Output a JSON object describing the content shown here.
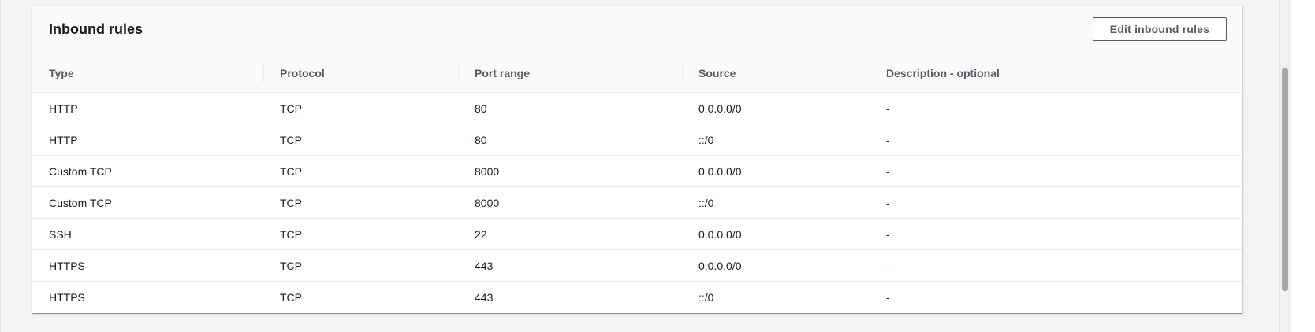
{
  "panel": {
    "title": "Inbound rules",
    "edit_button_label": "Edit inbound rules"
  },
  "table": {
    "columns": [
      "Type",
      "Protocol",
      "Port range",
      "Source",
      "Description - optional"
    ],
    "rows": [
      [
        "HTTP",
        "TCP",
        "80",
        "0.0.0.0/0",
        "-"
      ],
      [
        "HTTP",
        "TCP",
        "80",
        "::/0",
        "-"
      ],
      [
        "Custom TCP",
        "TCP",
        "8000",
        "0.0.0.0/0",
        "-"
      ],
      [
        "Custom TCP",
        "TCP",
        "8000",
        "::/0",
        "-"
      ],
      [
        "SSH",
        "TCP",
        "22",
        "0.0.0.0/0",
        "-"
      ],
      [
        "HTTPS",
        "TCP",
        "443",
        "0.0.0.0/0",
        "-"
      ],
      [
        "HTTPS",
        "TCP",
        "443",
        "::/0",
        "-"
      ]
    ]
  },
  "colors": {
    "page_background": "#f2f3f3",
    "panel_background": "#ffffff",
    "header_background": "#fafafa",
    "text_primary": "#16191f",
    "text_secondary": "#545b64",
    "border": "#eaeded"
  }
}
